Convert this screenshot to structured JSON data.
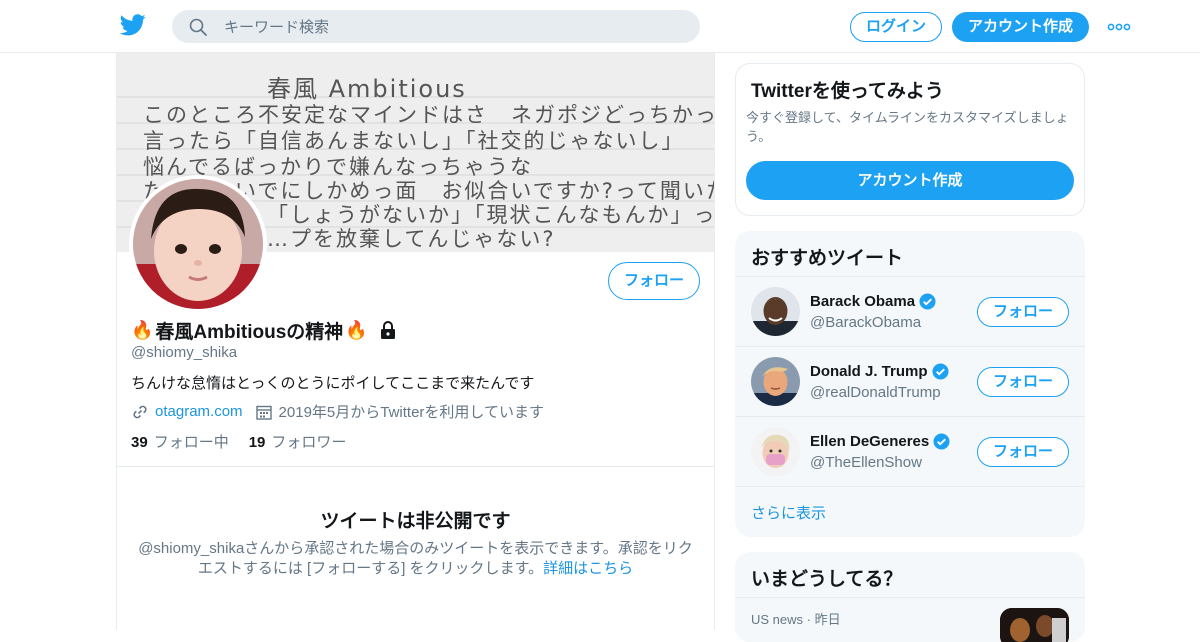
{
  "topbar": {
    "search_placeholder": "キーワード検索",
    "login_label": "ログイン",
    "signup_label": "アカウント作成",
    "brand_color": "#1da1f2",
    "icons": [
      "twitter-logo-icon",
      "search-icon",
      "more-icon"
    ]
  },
  "profile": {
    "banner_lines": [
      "春風 Ambitious",
      "このところ不安定なマインドはさ　ネガポジどっちかって",
      "言ったら「自信あんまないし」「社交的じゃないし」",
      "悩んでるばっかりで嫌んなっちゃうな",
      "たにかついでにしかめっ面　お似合いですか?って聞いたら",
      "「しょうがないか」「現状こんなもんか」って",
      "…プを放棄してんじゃない?"
    ],
    "follow_label": "フォロー",
    "name_emoji": "🔥",
    "name": "春風Ambitiousの精神",
    "handle": "@shiomy_shika",
    "bio": "ちんけな怠惰はとっくのとうにポイしてここまで来たんです",
    "website": "otagram.com",
    "joined": "2019年5月からTwitterを利用しています",
    "following_count": "39",
    "following_label": "フォロー中",
    "followers_count": "19",
    "followers_label": "フォロワー",
    "protected_title": "ツイートは非公開です",
    "protected_text": "@shiomy_shikaさんから承認された場合のみツイートを表示できます。承認をリクエストするには [フォローする] をクリックします。",
    "protected_link": "詳細はこちら"
  },
  "signup_card": {
    "title": "Twitterを使ってみよう",
    "description": "今すぐ登録して、タイムラインをカスタマイズしましょう。",
    "button_label": "アカウント作成"
  },
  "who_to_follow": {
    "title": "おすすめツイート",
    "accounts": [
      {
        "name": "Barack Obama",
        "handle": "@BarackObama",
        "follow_label": "フォロー",
        "verified": true
      },
      {
        "name": "Donald J. Trump",
        "handle": "@realDonaldTrump",
        "follow_label": "フォロー",
        "verified": true
      },
      {
        "name": "Ellen DeGeneres",
        "handle": "@TheEllenShow",
        "follow_label": "フォロー",
        "verified": true
      }
    ],
    "show_more": "さらに表示"
  },
  "trends": {
    "title": "いまどうしてる？",
    "item_category": "US news",
    "item_dot": "·",
    "item_time": "昨日"
  }
}
